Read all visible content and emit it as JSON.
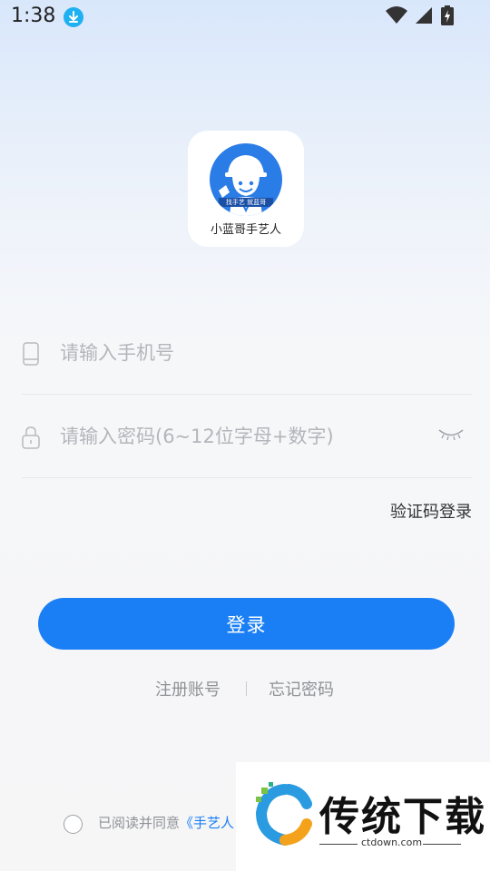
{
  "status_bar": {
    "time": "1:38"
  },
  "logo": {
    "caption": "小蓝哥手艺人",
    "badge_text": "找手艺 就蓝哥"
  },
  "form": {
    "phone_placeholder": "请输入手机号",
    "password_placeholder": "请输入密码(6~12位字母+数字)",
    "sms_login_label": "验证码登录",
    "login_button_label": "登录"
  },
  "links": {
    "register": "注册账号",
    "forgot": "忘记密码"
  },
  "agreement": {
    "prefix": "已阅读并同意",
    "link_text": "《手艺人"
  },
  "watermark": {
    "title": "传统下载",
    "url": "ctdown.com"
  },
  "colors": {
    "accent": "#1a7ff5",
    "placeholder": "#b3b6bb"
  }
}
